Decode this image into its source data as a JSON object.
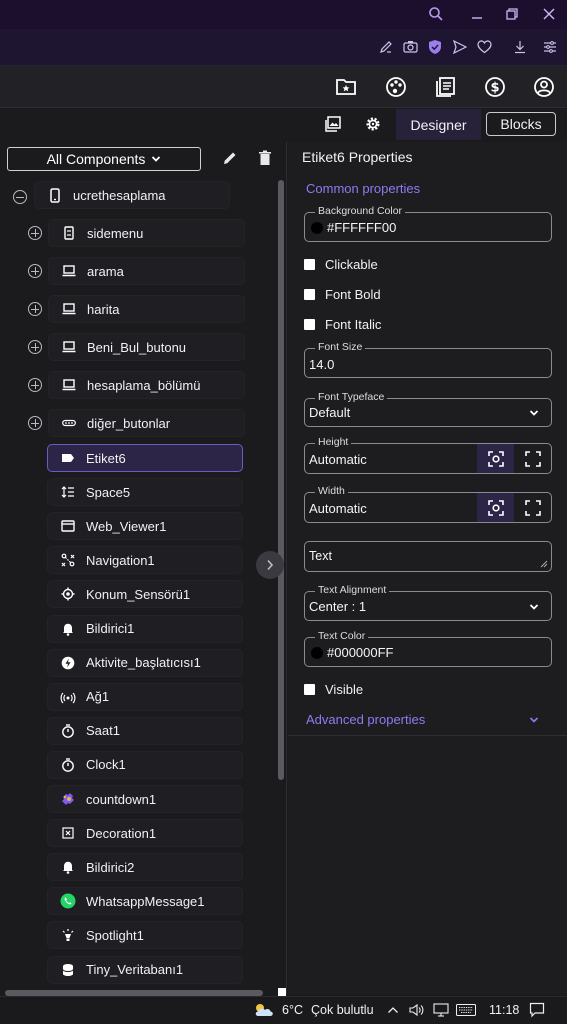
{
  "browser": {
    "title_icons": [
      "search-icon",
      "minimize-icon",
      "restore-icon",
      "close-icon"
    ],
    "toolbar_icons": [
      "edit-icon",
      "camera-icon",
      "shield-check-icon",
      "send-icon",
      "heart-icon",
      "download-icon",
      "menu-icon"
    ]
  },
  "header": {
    "icons": [
      "folder-star-icon",
      "palette-icon",
      "document-list-icon",
      "dollar-icon",
      "account-icon"
    ]
  },
  "modebar": {
    "designer_label": "Designer",
    "blocks_label": "Blocks",
    "icons": [
      "image-icon",
      "gear-icon"
    ]
  },
  "components": {
    "filter_label": "All Components",
    "root": "ucrethesaplama",
    "items": [
      {
        "label": "sidemenu",
        "icon": "menu-vertical-icon",
        "expandable": true
      },
      {
        "label": "arama",
        "icon": "laptop-icon",
        "expandable": true
      },
      {
        "label": "harita",
        "icon": "laptop-icon",
        "expandable": true
      },
      {
        "label": "Beni_Bul_butonu",
        "icon": "laptop-icon",
        "expandable": true
      },
      {
        "label": "hesaplama_bölümü",
        "icon": "laptop-icon",
        "expandable": true
      },
      {
        "label": "diğer_butonlar",
        "icon": "dots-icon",
        "expandable": true
      },
      {
        "label": "Etiket6",
        "icon": "label-icon",
        "selected": true
      },
      {
        "label": "Space5",
        "icon": "spacing-icon"
      },
      {
        "label": "Web_Viewer1",
        "icon": "window-icon"
      },
      {
        "label": "Navigation1",
        "icon": "route-icon"
      },
      {
        "label": "Konum_Sensörü1",
        "icon": "location-icon"
      },
      {
        "label": "Bildirici1",
        "icon": "bell-icon"
      },
      {
        "label": "Aktivite_başlatıcısı1",
        "icon": "lightning-icon"
      },
      {
        "label": "Ağ1",
        "icon": "wifi-icon"
      },
      {
        "label": "Saat1",
        "icon": "timer-icon"
      },
      {
        "label": "Clock1",
        "icon": "timer-icon"
      },
      {
        "label": "countdown1",
        "icon": "puzzle-icon"
      },
      {
        "label": "Decoration1",
        "icon": "decoration-icon"
      },
      {
        "label": "Bildirici2",
        "icon": "bell-icon"
      },
      {
        "label": "WhatsappMessage1",
        "icon": "whatsapp-icon"
      },
      {
        "label": "Spotlight1",
        "icon": "spotlight-icon"
      },
      {
        "label": "Tiny_Veritabanı1",
        "icon": "database-icon"
      }
    ]
  },
  "properties": {
    "title": "Etiket6 Properties",
    "common_label": "Common properties",
    "advanced_label": "Advanced properties",
    "background_color": {
      "label": "Background Color",
      "value": "#FFFFFF00",
      "swatch": "#000000"
    },
    "clickable": {
      "label": "Clickable",
      "checked": false
    },
    "font_bold": {
      "label": "Font Bold",
      "checked": false
    },
    "font_italic": {
      "label": "Font Italic",
      "checked": false
    },
    "font_size": {
      "label": "Font Size",
      "value": "14.0"
    },
    "font_typeface": {
      "label": "Font Typeface",
      "value": "Default"
    },
    "height": {
      "label": "Height",
      "value": "Automatic"
    },
    "width": {
      "label": "Width",
      "value": "Automatic"
    },
    "text": {
      "value": "Text"
    },
    "text_alignment": {
      "label": "Text Alignment",
      "value": "Center : 1"
    },
    "text_color": {
      "label": "Text Color",
      "value": "#000000FF",
      "swatch": "#000000"
    },
    "visible": {
      "label": "Visible",
      "checked": false
    }
  },
  "taskbar": {
    "weather_temp": "6°C",
    "weather_text": "Çok bulutlu",
    "time": "11:18"
  },
  "colors": {
    "accent": "#8f7bf0",
    "selected_border": "#6e5bc4"
  }
}
